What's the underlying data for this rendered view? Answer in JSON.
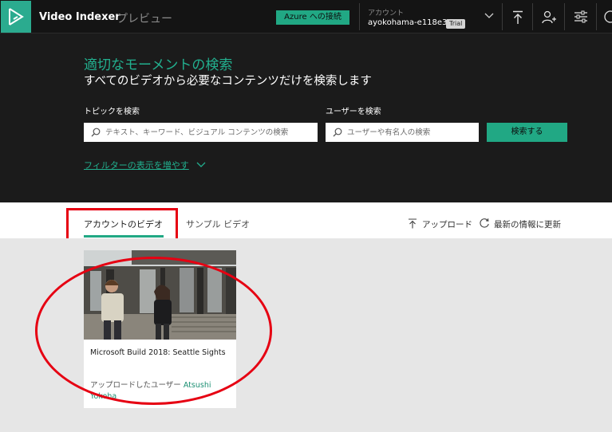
{
  "app": {
    "name": "Video Indexer",
    "preview_label": "プレビュー",
    "azure_connect_label": "Azure への接続",
    "account_caption": "アカウント",
    "account_id": "ayokohama-e118e3",
    "trial_badge": "Trial"
  },
  "hero": {
    "title": "適切なモーメントの検索",
    "subtitle": "すべてのビデオから必要なコンテンツだけを検索します",
    "topic_label": "トピックを検索",
    "topic_placeholder": "テキスト、キーワード、ビジュアル コンテンツの検索",
    "user_label": "ユーザーを検索",
    "user_placeholder": "ユーザーや有名人の検索",
    "search_button": "検索する",
    "filter_link": "フィルターの表示を増やす"
  },
  "tabs": [
    {
      "label": "アカウントのビデオ",
      "active": true
    },
    {
      "label": "サンプル ビデオ",
      "active": false
    }
  ],
  "actions": {
    "upload": "アップロード",
    "refresh": "最新の情報に更新"
  },
  "videos": [
    {
      "title": "Microsoft Build 2018: Seattle Sights",
      "uploaded_by_label": "アップロードしたユーザー",
      "uploader": "Atsushi Yokoha"
    }
  ],
  "colors": {
    "accent": "#21a884",
    "dark_bg": "#1b1b1b",
    "annotation_red": "#e60012"
  }
}
